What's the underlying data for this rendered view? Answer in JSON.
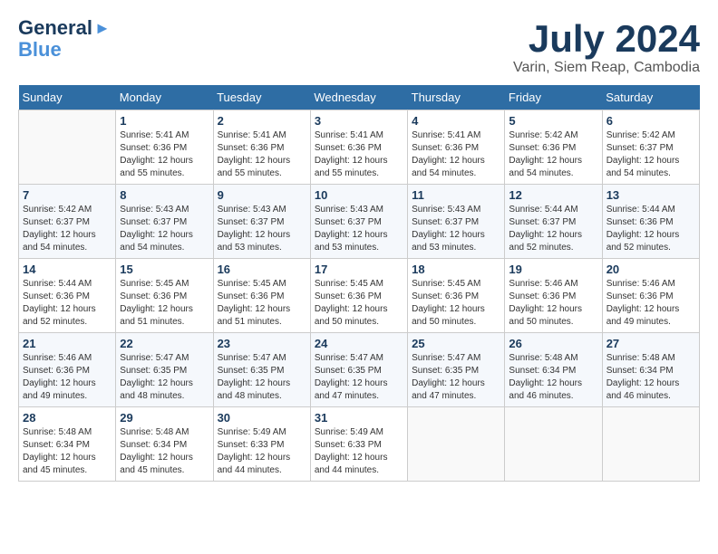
{
  "logo": {
    "general": "General",
    "blue": "Blue"
  },
  "title": {
    "month": "July 2024",
    "location": "Varin, Siem Reap, Cambodia"
  },
  "calendar": {
    "headers": [
      "Sunday",
      "Monday",
      "Tuesday",
      "Wednesday",
      "Thursday",
      "Friday",
      "Saturday"
    ],
    "weeks": [
      [
        {
          "day": "",
          "info": ""
        },
        {
          "day": "1",
          "info": "Sunrise: 5:41 AM\nSunset: 6:36 PM\nDaylight: 12 hours\nand 55 minutes."
        },
        {
          "day": "2",
          "info": "Sunrise: 5:41 AM\nSunset: 6:36 PM\nDaylight: 12 hours\nand 55 minutes."
        },
        {
          "day": "3",
          "info": "Sunrise: 5:41 AM\nSunset: 6:36 PM\nDaylight: 12 hours\nand 55 minutes."
        },
        {
          "day": "4",
          "info": "Sunrise: 5:41 AM\nSunset: 6:36 PM\nDaylight: 12 hours\nand 54 minutes."
        },
        {
          "day": "5",
          "info": "Sunrise: 5:42 AM\nSunset: 6:36 PM\nDaylight: 12 hours\nand 54 minutes."
        },
        {
          "day": "6",
          "info": "Sunrise: 5:42 AM\nSunset: 6:37 PM\nDaylight: 12 hours\nand 54 minutes."
        }
      ],
      [
        {
          "day": "7",
          "info": "Sunrise: 5:42 AM\nSunset: 6:37 PM\nDaylight: 12 hours\nand 54 minutes."
        },
        {
          "day": "8",
          "info": "Sunrise: 5:43 AM\nSunset: 6:37 PM\nDaylight: 12 hours\nand 54 minutes."
        },
        {
          "day": "9",
          "info": "Sunrise: 5:43 AM\nSunset: 6:37 PM\nDaylight: 12 hours\nand 53 minutes."
        },
        {
          "day": "10",
          "info": "Sunrise: 5:43 AM\nSunset: 6:37 PM\nDaylight: 12 hours\nand 53 minutes."
        },
        {
          "day": "11",
          "info": "Sunrise: 5:43 AM\nSunset: 6:37 PM\nDaylight: 12 hours\nand 53 minutes."
        },
        {
          "day": "12",
          "info": "Sunrise: 5:44 AM\nSunset: 6:37 PM\nDaylight: 12 hours\nand 52 minutes."
        },
        {
          "day": "13",
          "info": "Sunrise: 5:44 AM\nSunset: 6:36 PM\nDaylight: 12 hours\nand 52 minutes."
        }
      ],
      [
        {
          "day": "14",
          "info": "Sunrise: 5:44 AM\nSunset: 6:36 PM\nDaylight: 12 hours\nand 52 minutes."
        },
        {
          "day": "15",
          "info": "Sunrise: 5:45 AM\nSunset: 6:36 PM\nDaylight: 12 hours\nand 51 minutes."
        },
        {
          "day": "16",
          "info": "Sunrise: 5:45 AM\nSunset: 6:36 PM\nDaylight: 12 hours\nand 51 minutes."
        },
        {
          "day": "17",
          "info": "Sunrise: 5:45 AM\nSunset: 6:36 PM\nDaylight: 12 hours\nand 50 minutes."
        },
        {
          "day": "18",
          "info": "Sunrise: 5:45 AM\nSunset: 6:36 PM\nDaylight: 12 hours\nand 50 minutes."
        },
        {
          "day": "19",
          "info": "Sunrise: 5:46 AM\nSunset: 6:36 PM\nDaylight: 12 hours\nand 50 minutes."
        },
        {
          "day": "20",
          "info": "Sunrise: 5:46 AM\nSunset: 6:36 PM\nDaylight: 12 hours\nand 49 minutes."
        }
      ],
      [
        {
          "day": "21",
          "info": "Sunrise: 5:46 AM\nSunset: 6:36 PM\nDaylight: 12 hours\nand 49 minutes."
        },
        {
          "day": "22",
          "info": "Sunrise: 5:47 AM\nSunset: 6:35 PM\nDaylight: 12 hours\nand 48 minutes."
        },
        {
          "day": "23",
          "info": "Sunrise: 5:47 AM\nSunset: 6:35 PM\nDaylight: 12 hours\nand 48 minutes."
        },
        {
          "day": "24",
          "info": "Sunrise: 5:47 AM\nSunset: 6:35 PM\nDaylight: 12 hours\nand 47 minutes."
        },
        {
          "day": "25",
          "info": "Sunrise: 5:47 AM\nSunset: 6:35 PM\nDaylight: 12 hours\nand 47 minutes."
        },
        {
          "day": "26",
          "info": "Sunrise: 5:48 AM\nSunset: 6:34 PM\nDaylight: 12 hours\nand 46 minutes."
        },
        {
          "day": "27",
          "info": "Sunrise: 5:48 AM\nSunset: 6:34 PM\nDaylight: 12 hours\nand 46 minutes."
        }
      ],
      [
        {
          "day": "28",
          "info": "Sunrise: 5:48 AM\nSunset: 6:34 PM\nDaylight: 12 hours\nand 45 minutes."
        },
        {
          "day": "29",
          "info": "Sunrise: 5:48 AM\nSunset: 6:34 PM\nDaylight: 12 hours\nand 45 minutes."
        },
        {
          "day": "30",
          "info": "Sunrise: 5:49 AM\nSunset: 6:33 PM\nDaylight: 12 hours\nand 44 minutes."
        },
        {
          "day": "31",
          "info": "Sunrise: 5:49 AM\nSunset: 6:33 PM\nDaylight: 12 hours\nand 44 minutes."
        },
        {
          "day": "",
          "info": ""
        },
        {
          "day": "",
          "info": ""
        },
        {
          "day": "",
          "info": ""
        }
      ]
    ]
  }
}
